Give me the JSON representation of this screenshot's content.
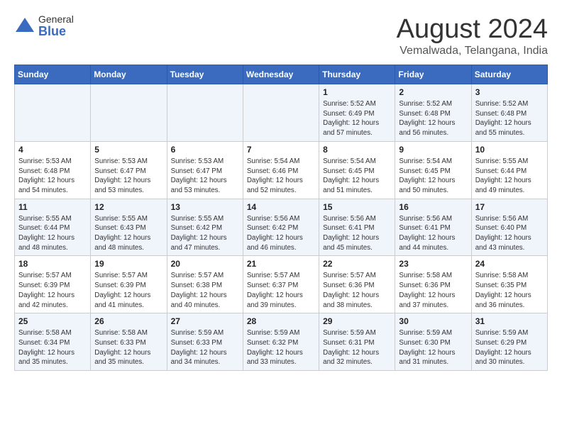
{
  "logo": {
    "general": "General",
    "blue": "Blue"
  },
  "title": "August 2024",
  "location": "Vemalwada, Telangana, India",
  "days_of_week": [
    "Sunday",
    "Monday",
    "Tuesday",
    "Wednesday",
    "Thursday",
    "Friday",
    "Saturday"
  ],
  "weeks": [
    [
      {
        "day": "",
        "info": ""
      },
      {
        "day": "",
        "info": ""
      },
      {
        "day": "",
        "info": ""
      },
      {
        "day": "",
        "info": ""
      },
      {
        "day": "1",
        "info": "Sunrise: 5:52 AM\nSunset: 6:49 PM\nDaylight: 12 hours\nand 57 minutes."
      },
      {
        "day": "2",
        "info": "Sunrise: 5:52 AM\nSunset: 6:48 PM\nDaylight: 12 hours\nand 56 minutes."
      },
      {
        "day": "3",
        "info": "Sunrise: 5:52 AM\nSunset: 6:48 PM\nDaylight: 12 hours\nand 55 minutes."
      }
    ],
    [
      {
        "day": "4",
        "info": "Sunrise: 5:53 AM\nSunset: 6:48 PM\nDaylight: 12 hours\nand 54 minutes."
      },
      {
        "day": "5",
        "info": "Sunrise: 5:53 AM\nSunset: 6:47 PM\nDaylight: 12 hours\nand 53 minutes."
      },
      {
        "day": "6",
        "info": "Sunrise: 5:53 AM\nSunset: 6:47 PM\nDaylight: 12 hours\nand 53 minutes."
      },
      {
        "day": "7",
        "info": "Sunrise: 5:54 AM\nSunset: 6:46 PM\nDaylight: 12 hours\nand 52 minutes."
      },
      {
        "day": "8",
        "info": "Sunrise: 5:54 AM\nSunset: 6:45 PM\nDaylight: 12 hours\nand 51 minutes."
      },
      {
        "day": "9",
        "info": "Sunrise: 5:54 AM\nSunset: 6:45 PM\nDaylight: 12 hours\nand 50 minutes."
      },
      {
        "day": "10",
        "info": "Sunrise: 5:55 AM\nSunset: 6:44 PM\nDaylight: 12 hours\nand 49 minutes."
      }
    ],
    [
      {
        "day": "11",
        "info": "Sunrise: 5:55 AM\nSunset: 6:44 PM\nDaylight: 12 hours\nand 48 minutes."
      },
      {
        "day": "12",
        "info": "Sunrise: 5:55 AM\nSunset: 6:43 PM\nDaylight: 12 hours\nand 48 minutes."
      },
      {
        "day": "13",
        "info": "Sunrise: 5:55 AM\nSunset: 6:42 PM\nDaylight: 12 hours\nand 47 minutes."
      },
      {
        "day": "14",
        "info": "Sunrise: 5:56 AM\nSunset: 6:42 PM\nDaylight: 12 hours\nand 46 minutes."
      },
      {
        "day": "15",
        "info": "Sunrise: 5:56 AM\nSunset: 6:41 PM\nDaylight: 12 hours\nand 45 minutes."
      },
      {
        "day": "16",
        "info": "Sunrise: 5:56 AM\nSunset: 6:41 PM\nDaylight: 12 hours\nand 44 minutes."
      },
      {
        "day": "17",
        "info": "Sunrise: 5:56 AM\nSunset: 6:40 PM\nDaylight: 12 hours\nand 43 minutes."
      }
    ],
    [
      {
        "day": "18",
        "info": "Sunrise: 5:57 AM\nSunset: 6:39 PM\nDaylight: 12 hours\nand 42 minutes."
      },
      {
        "day": "19",
        "info": "Sunrise: 5:57 AM\nSunset: 6:39 PM\nDaylight: 12 hours\nand 41 minutes."
      },
      {
        "day": "20",
        "info": "Sunrise: 5:57 AM\nSunset: 6:38 PM\nDaylight: 12 hours\nand 40 minutes."
      },
      {
        "day": "21",
        "info": "Sunrise: 5:57 AM\nSunset: 6:37 PM\nDaylight: 12 hours\nand 39 minutes."
      },
      {
        "day": "22",
        "info": "Sunrise: 5:57 AM\nSunset: 6:36 PM\nDaylight: 12 hours\nand 38 minutes."
      },
      {
        "day": "23",
        "info": "Sunrise: 5:58 AM\nSunset: 6:36 PM\nDaylight: 12 hours\nand 37 minutes."
      },
      {
        "day": "24",
        "info": "Sunrise: 5:58 AM\nSunset: 6:35 PM\nDaylight: 12 hours\nand 36 minutes."
      }
    ],
    [
      {
        "day": "25",
        "info": "Sunrise: 5:58 AM\nSunset: 6:34 PM\nDaylight: 12 hours\nand 35 minutes."
      },
      {
        "day": "26",
        "info": "Sunrise: 5:58 AM\nSunset: 6:33 PM\nDaylight: 12 hours\nand 35 minutes."
      },
      {
        "day": "27",
        "info": "Sunrise: 5:59 AM\nSunset: 6:33 PM\nDaylight: 12 hours\nand 34 minutes."
      },
      {
        "day": "28",
        "info": "Sunrise: 5:59 AM\nSunset: 6:32 PM\nDaylight: 12 hours\nand 33 minutes."
      },
      {
        "day": "29",
        "info": "Sunrise: 5:59 AM\nSunset: 6:31 PM\nDaylight: 12 hours\nand 32 minutes."
      },
      {
        "day": "30",
        "info": "Sunrise: 5:59 AM\nSunset: 6:30 PM\nDaylight: 12 hours\nand 31 minutes."
      },
      {
        "day": "31",
        "info": "Sunrise: 5:59 AM\nSunset: 6:29 PM\nDaylight: 12 hours\nand 30 minutes."
      }
    ]
  ]
}
